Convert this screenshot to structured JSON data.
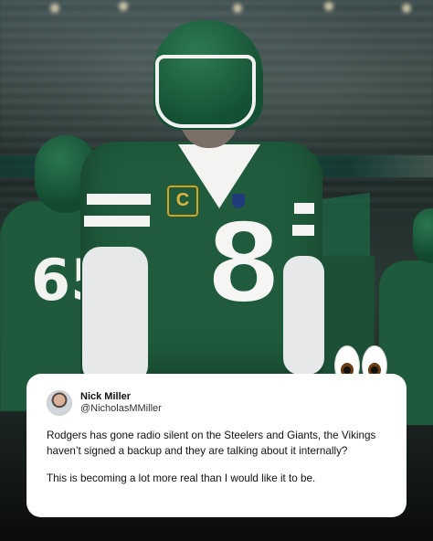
{
  "tweet": {
    "display_name": "Nick Miller",
    "handle": "@NicholasMMiller",
    "paragraphs": [
      "Rodgers has gone radio silent on the Steelers and Giants, the Vikings haven’t signed a backup and they are talking about it internally?",
      "This is becoming a lot more real than I would like it to be."
    ]
  },
  "photo": {
    "jersey_number": "8",
    "captain_patch": "C",
    "left_player_number": "65"
  },
  "overlay": {
    "emoji": "eyes-icon"
  },
  "colors": {
    "jersey_green": "#1f5b3c",
    "card_background": "#ffffff",
    "captain_gold": "#d4a21d"
  }
}
